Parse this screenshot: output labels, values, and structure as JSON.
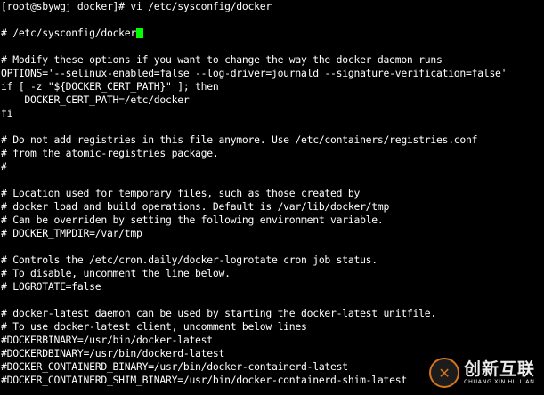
{
  "terminal": {
    "prompt": "[root@sbywgj docker]# vi /etc/sysconfig/docker",
    "lines": [
      "",
      "# /etc/sysconfig/docker",
      "",
      "# Modify these options if you want to change the way the docker daemon runs",
      "OPTIONS='--selinux-enabled=false --log-driver=journald --signature-verification=false'",
      "if [ -z \"${DOCKER_CERT_PATH}\" ]; then",
      "    DOCKER_CERT_PATH=/etc/docker",
      "fi",
      "",
      "# Do not add registries in this file anymore. Use /etc/containers/registries.conf",
      "# from the atomic-registries package.",
      "#",
      "",
      "# Location used for temporary files, such as those created by",
      "# docker load and build operations. Default is /var/lib/docker/tmp",
      "# Can be overriden by setting the following environment variable.",
      "# DOCKER_TMPDIR=/var/tmp",
      "",
      "# Controls the /etc/cron.daily/docker-logrotate cron job status.",
      "# To disable, uncomment the line below.",
      "# LOGROTATE=false",
      "",
      "# docker-latest daemon can be used by starting the docker-latest unitfile.",
      "# To use docker-latest client, uncomment below lines",
      "#DOCKERBINARY=/usr/bin/docker-latest",
      "#DOCKERDBINARY=/usr/bin/dockerd-latest",
      "#DOCKER_CONTAINERD_BINARY=/usr/bin/docker-containerd-latest",
      "#DOCKER_CONTAINERD_SHIM_BINARY=/usr/bin/docker-containerd-shim-latest"
    ]
  },
  "watermark": {
    "logo_glyph": "✕",
    "name": "创新互联",
    "subtitle": "CHUANG XIN HU LIAN"
  },
  "colors": {
    "background": "#000000",
    "text": "#ffffff",
    "cursor": "#00ff00",
    "watermark_accent": "#e67e22"
  }
}
